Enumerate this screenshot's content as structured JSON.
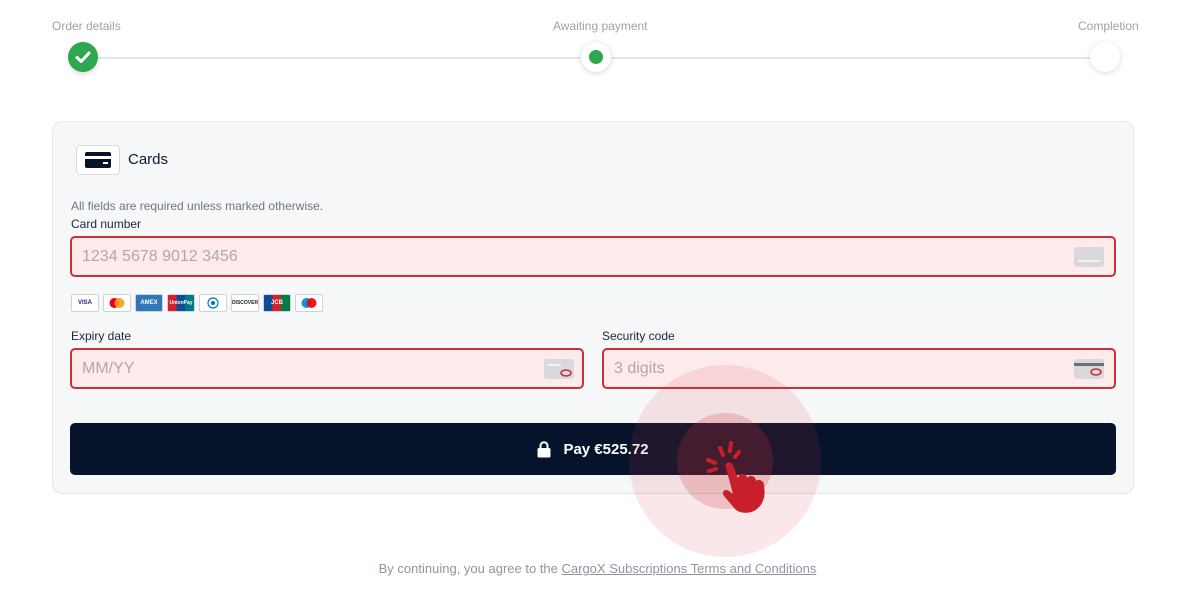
{
  "stepper": {
    "steps": [
      {
        "label": "Order details",
        "state": "done"
      },
      {
        "label": "Awaiting payment",
        "state": "active"
      },
      {
        "label": "Completion",
        "state": "pending"
      }
    ]
  },
  "payment": {
    "method_title": "Cards",
    "required_note": "All fields are required unless marked otherwise.",
    "card_number": {
      "label": "Card number",
      "placeholder": "1234 5678 9012 3456",
      "value": ""
    },
    "expiry": {
      "label": "Expiry date",
      "placeholder": "MM/YY",
      "value": ""
    },
    "security": {
      "label": "Security code",
      "placeholder": "3 digits",
      "value": ""
    },
    "brands": [
      {
        "name": "VISA",
        "icon": "visa-logo"
      },
      {
        "name": "",
        "icon": "mastercard-logo"
      },
      {
        "name": "AMEX",
        "icon": "amex-logo"
      },
      {
        "name": "UnionPay",
        "icon": "unionpay-logo"
      },
      {
        "name": "",
        "icon": "diners-logo"
      },
      {
        "name": "DISCOVER",
        "icon": "discover-logo"
      },
      {
        "name": "JCB",
        "icon": "jcb-logo"
      },
      {
        "name": "",
        "icon": "maestro-logo"
      }
    ],
    "pay_button": "Pay €525.72"
  },
  "footer": {
    "prefix": "By continuing, you agree to the ",
    "link": "CargoX Subscriptions Terms and Conditions"
  },
  "colors": {
    "success": "#2ea84f",
    "error_border": "#c8313a",
    "error_bg": "#fdeaea",
    "button": "#06132b"
  }
}
